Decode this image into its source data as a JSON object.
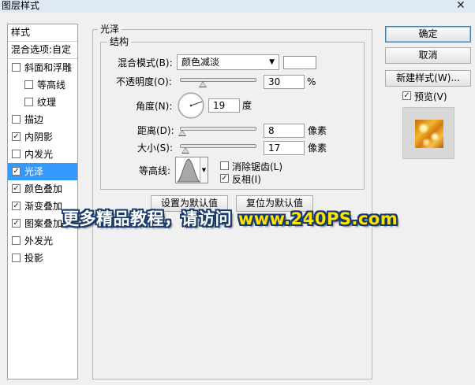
{
  "window": {
    "title": "图层样式",
    "close_glyph": "✕"
  },
  "left_panel": {
    "header_styles": "样式",
    "header_blend": "混合选项:自定",
    "items": [
      {
        "label": "斜面和浮雕",
        "checked": false,
        "indent": false
      },
      {
        "label": "等高线",
        "checked": false,
        "indent": true
      },
      {
        "label": "纹理",
        "checked": false,
        "indent": true
      },
      {
        "label": "描边",
        "checked": false,
        "indent": false
      },
      {
        "label": "内阴影",
        "checked": true,
        "indent": false
      },
      {
        "label": "内发光",
        "checked": false,
        "indent": false
      },
      {
        "label": "光泽",
        "checked": true,
        "indent": false,
        "selected": true
      },
      {
        "label": "颜色叠加",
        "checked": true,
        "indent": false
      },
      {
        "label": "渐变叠加",
        "checked": true,
        "indent": false
      },
      {
        "label": "图案叠加",
        "checked": true,
        "indent": false
      },
      {
        "label": "外发光",
        "checked": false,
        "indent": false
      },
      {
        "label": "投影",
        "checked": false,
        "indent": false
      }
    ]
  },
  "satin": {
    "group_title": "光泽",
    "structure_title": "结构",
    "blend_mode": {
      "label": "混合模式(B):",
      "value": "颜色减淡",
      "color": "#ffffff"
    },
    "opacity": {
      "label": "不透明度(O):",
      "value": "30",
      "unit": "%",
      "level": 0.3
    },
    "angle": {
      "label": "角度(N):",
      "value": "19",
      "unit": "度"
    },
    "distance": {
      "label": "距离(D):",
      "value": "8",
      "unit": "像素",
      "level": 0.03
    },
    "size": {
      "label": "大小(S):",
      "value": "17",
      "unit": "像素",
      "level": 0.07
    },
    "contour": {
      "label": "等高线:"
    },
    "anti_alias": {
      "label": "消除锯齿(L)",
      "checked": false
    },
    "invert": {
      "label": "反相(I)",
      "checked": true
    },
    "btn_default_set": "设置为默认值",
    "btn_default_reset": "复位为默认值"
  },
  "right_panel": {
    "ok": "确定",
    "cancel": "取消",
    "new_style": "新建样式(W)...",
    "preview_label": "预览(V)",
    "preview_checked": true
  },
  "watermark": {
    "prefix": "更多精品教程，请访问 ",
    "site": "www.240PS.com"
  },
  "colors": {
    "selection": "#3399ff",
    "watermark_site": "#ffe400",
    "watermark_outline": "#183a6a",
    "preview_gold": "#e8a020"
  }
}
